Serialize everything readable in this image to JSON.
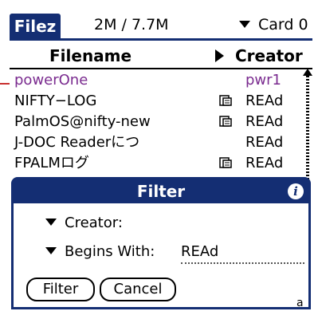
{
  "app": {
    "title": "Filez",
    "usage": "2M / 7.7M",
    "card_label": "Card 0"
  },
  "columns": {
    "filename": "Filename",
    "creator": "Creator"
  },
  "files": [
    {
      "name": "powerOne",
      "creator": "pwr1",
      "locked": false,
      "selected": true
    },
    {
      "name": "NIFTY−LOG",
      "creator": "REAd",
      "locked": true,
      "selected": false
    },
    {
      "name": "PalmOS@nifty-new",
      "creator": "REAd",
      "locked": true,
      "selected": false
    },
    {
      "name": "J-DOC Readerにつ",
      "creator": "REAd",
      "locked": false,
      "selected": false
    },
    {
      "name": "FPALMログ",
      "creator": "REAd",
      "locked": true,
      "selected": false
    }
  ],
  "dialog": {
    "title": "Filter",
    "info_icon": "i",
    "creator_label": "Creator:",
    "begins_with_label": "Begins With:",
    "begins_with_value": "REAd",
    "filter_button": "Filter",
    "cancel_button": "Cancel",
    "graffiti_indicator": "a"
  },
  "icons": {
    "lock": "lock-icon",
    "triangle_right": "triangle-right-icon",
    "triangle_down": "triangle-down-icon",
    "info": "info-icon",
    "scroll_up": "scroll-up-arrow-icon"
  },
  "colors": {
    "titlebar": "#142e73",
    "selected_text": "#7a2b8f",
    "marker": "#c8302f"
  }
}
